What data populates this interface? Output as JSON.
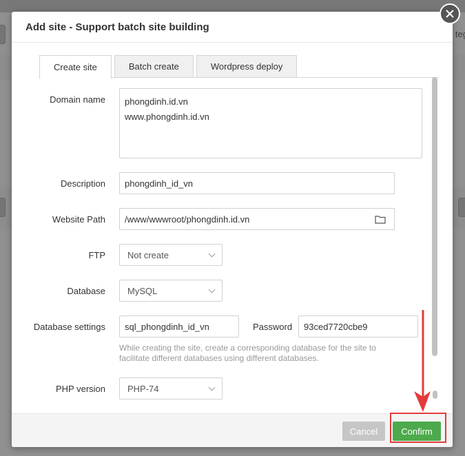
{
  "background": {
    "right_text": "teg"
  },
  "dialog": {
    "title": "Add site - Support batch site building",
    "tabs": [
      {
        "label": "Create site",
        "active": true
      },
      {
        "label": "Batch create",
        "active": false
      },
      {
        "label": "Wordpress deploy",
        "active": false
      }
    ],
    "domain": {
      "label": "Domain name",
      "lines": [
        "phongdinh.id.vn",
        "www.phongdinh.id.vn"
      ]
    },
    "description": {
      "label": "Description",
      "value": "phongdinh_id_vn"
    },
    "website_path": {
      "label": "Website Path",
      "value": "/www/wwwroot/phongdinh.id.vn"
    },
    "ftp": {
      "label": "FTP",
      "selected": "Not create"
    },
    "database": {
      "label": "Database",
      "selected": "MySQL"
    },
    "database_settings": {
      "label": "Database settings",
      "name_value": "sql_phongdinh_id_vn",
      "password_label": "Password",
      "password_value": "93ced7720cbe9",
      "hint": "While creating the site, create a corresponding database for the site to facilitate different databases using different databases."
    },
    "php_version": {
      "label": "PHP version",
      "selected": "PHP-74"
    },
    "footer": {
      "cancel_label": "Cancel",
      "confirm_label": "Confirm"
    }
  },
  "colors": {
    "confirm": "#4caa4c",
    "annotation": "#e53b3b"
  }
}
